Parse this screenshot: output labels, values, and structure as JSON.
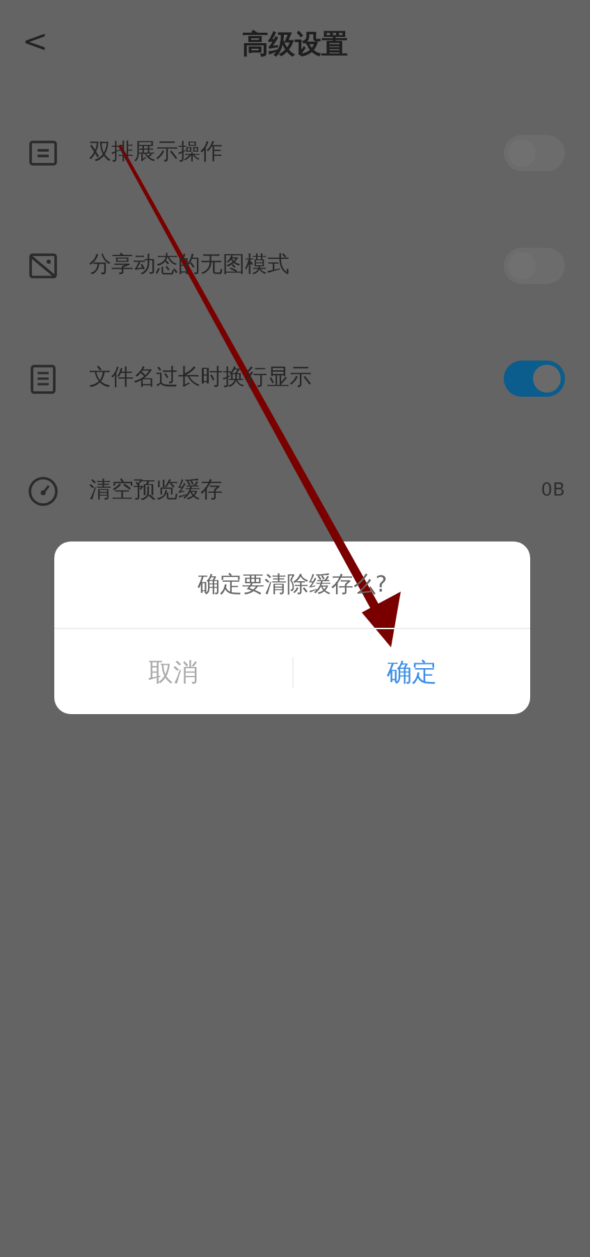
{
  "header": {
    "back": "<",
    "title": "高级设置"
  },
  "settings": [
    {
      "kind": "toggle",
      "label": "双排展示操作",
      "on": false
    },
    {
      "kind": "toggle",
      "label": "分享动态的无图模式",
      "on": false
    },
    {
      "kind": "toggle",
      "label": "文件名过长时换行显示",
      "on": true
    },
    {
      "kind": "value",
      "label": "清空预览缓存",
      "value": "0B"
    }
  ],
  "dialog": {
    "message": "确定要清除缓存么?",
    "buttons": [
      {
        "label": "取消",
        "kind": "cancel"
      },
      {
        "label": "确定",
        "kind": "confirm"
      }
    ]
  }
}
